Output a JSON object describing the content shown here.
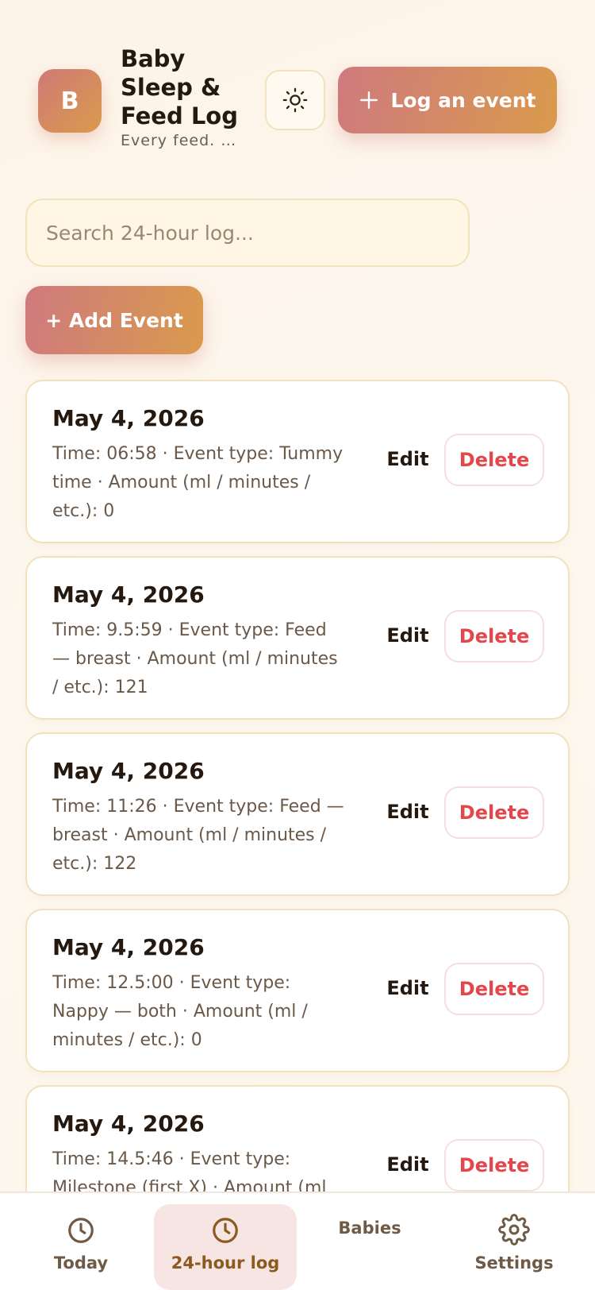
{
  "header": {
    "logo_letter": "B",
    "title": "Baby Sleep & Feed Log",
    "subtitle": "Every feed. …",
    "theme_toggle_icon": "sun-icon",
    "log_button_label": "Log an event"
  },
  "search": {
    "placeholder": "Search 24-hour log..."
  },
  "add_button_label": "+ Add Event",
  "entries": [
    {
      "date": "May 4, 2026",
      "detail": "Time: 06:58 · Event type: Tummy time · Amount (ml / minutes / etc.): 0",
      "edit": "Edit",
      "delete": "Delete"
    },
    {
      "date": "May 4, 2026",
      "detail": "Time: 9.5:59 · Event type: Feed — breast · Amount (ml / minutes / etc.): 121",
      "edit": "Edit",
      "delete": "Delete"
    },
    {
      "date": "May 4, 2026",
      "detail": "Time: 11:26 · Event type: Feed — breast · Amount (ml / minutes / etc.): 122",
      "edit": "Edit",
      "delete": "Delete"
    },
    {
      "date": "May 4, 2026",
      "detail": "Time: 12.5:00 · Event type: Nappy — both · Amount (ml / minutes / etc.): 0",
      "edit": "Edit",
      "delete": "Delete"
    },
    {
      "date": "May 4, 2026",
      "detail": "Time: 14.5:46 · Event type: Milestone (first X) · Amount (ml",
      "edit": "Edit",
      "delete": "Delete"
    }
  ],
  "nav": [
    {
      "label": "Today",
      "icon": "clock-icon",
      "active": false
    },
    {
      "label": "24-hour log",
      "icon": "clock-icon",
      "active": true
    },
    {
      "label": "Babies",
      "icon": "",
      "active": false
    },
    {
      "label": "Settings",
      "icon": "gear-icon",
      "active": false
    }
  ],
  "colors": {
    "accent_start": "#cf7a7e",
    "accent_end": "#d99a4c",
    "delete_red": "#e3474c",
    "active_nav_bg": "#f6e5e3"
  }
}
